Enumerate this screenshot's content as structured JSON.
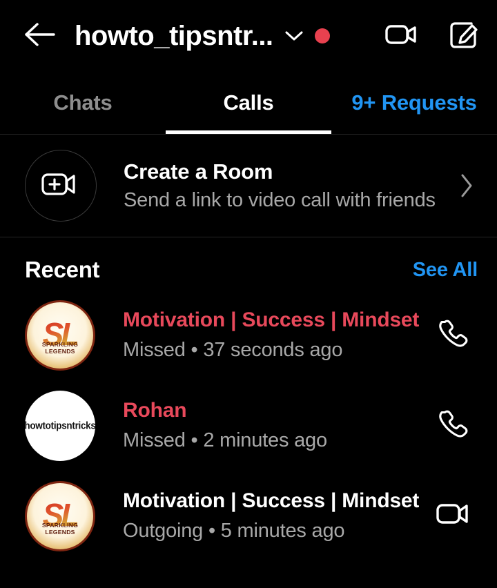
{
  "app": {
    "background_color": "#000000",
    "accent_blue": "#2195f3",
    "missed_red": "#e8495b",
    "secondary_text": "#a8a8a8"
  },
  "header": {
    "back_icon": "arrow-left-icon",
    "title": "howto_tipsntr...",
    "dropdown_icon": "chevron-down-icon",
    "status_dot": {
      "name": "unread-indicator-dot",
      "color": "#e8414f"
    },
    "video_call_icon": "video-camera-icon",
    "compose_icon": "compose-edit-icon"
  },
  "tabs": {
    "items": [
      {
        "label": "Chats",
        "state": "inactive"
      },
      {
        "label": "Calls",
        "state": "active"
      },
      {
        "label": "9+ Requests",
        "state": "link"
      }
    ],
    "active_index": 1
  },
  "create_room": {
    "icon": "video-camera-plus-icon",
    "title": "Create a Room",
    "subtitle": "Send a link to video call with friends",
    "chevron_icon": "chevron-right-icon"
  },
  "recent": {
    "heading": "Recent",
    "see_all_label": "See All",
    "calls": [
      {
        "name": "Motivation | Success | Mindset",
        "status": "Missed",
        "separator": "•",
        "time": "37 seconds ago",
        "meta": "Missed • 37 seconds ago",
        "name_style": "missed",
        "action_icon": "phone-icon",
        "avatar": {
          "type": "logo",
          "monogram": "SL",
          "caption": "SPARKLING LEGENDS"
        }
      },
      {
        "name": "Rohan",
        "status": "Missed",
        "separator": "•",
        "time": "2 minutes ago",
        "meta": "Missed • 2 minutes ago",
        "name_style": "missed",
        "action_icon": "phone-icon",
        "avatar": {
          "type": "text",
          "text": "howtotipsntricks"
        }
      },
      {
        "name": "Motivation | Success | Mindset",
        "status": "Outgoing",
        "separator": "•",
        "time": "5 minutes ago",
        "meta": "Outgoing • 5 minutes ago",
        "name_style": "normal",
        "action_icon": "video-camera-icon",
        "avatar": {
          "type": "logo",
          "monogram": "SL",
          "caption": "SPARKLING LEGENDS"
        }
      }
    ]
  }
}
